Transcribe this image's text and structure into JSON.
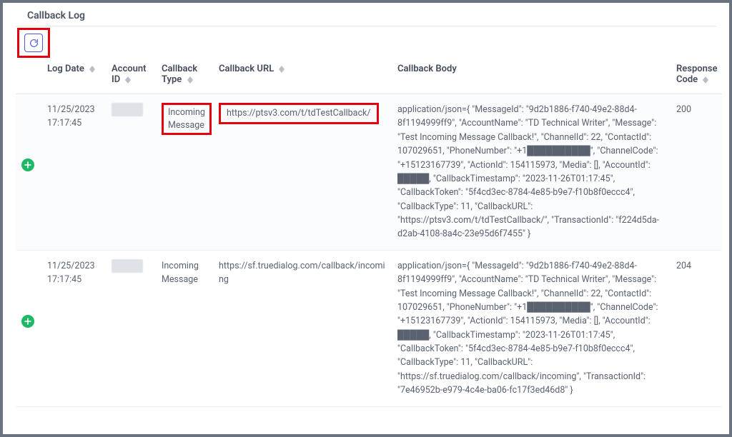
{
  "page_title": "Callback Log",
  "columns": {
    "log_date": "Log Date",
    "account_id": "Account ID",
    "callback_type": "Callback Type",
    "callback_url": "Callback URL",
    "callback_body": "Callback Body",
    "response_code": "Response Code"
  },
  "rows": [
    {
      "log_date": "11/25/2023 17:17:45",
      "account_id": "█████",
      "callback_type": "Incoming Message",
      "callback_url": "https://ptsv3.com/t/tdTestCallback/",
      "callback_body": "application/json={ \"MessageId\": \"9d2b1886-f740-49e2-88d4-8f1194999ff9\", \"AccountName\": \"TD Technical Writer\", \"Message\": \"Test Incoming Message Callback!\", \"ChannelId\": 22, \"ContactId\": 107029651, \"PhoneNumber\": \"+1██████████\", \"ChannelCode\": \"+15123167739\", \"ActionId\": 154115973, \"Media\": [], \"AccountId\": █████, \"CallbackTimestamp\": \"2023-11-26T01:17:45\", \"CallbackToken\": \"5f4cd3ec-8784-4e85-b9e7-f10b8f0eccc4\", \"CallbackType\": 11, \"CallbackURL\": \"https://ptsv3.com/t/tdTestCallback/\", \"TransactionId\": \"f224d5da-d2ab-4108-8a4c-23e95d6f7455\" }",
      "response_code": "200"
    },
    {
      "log_date": "11/25/2023 17:17:45",
      "account_id": "█████",
      "callback_type": "Incoming Message",
      "callback_url": "https://sf.truedialog.com/callback/incoming",
      "callback_body": "application/json={ \"MessageId\": \"9d2b1886-f740-49e2-88d4-8f1194999ff9\", \"AccountName\": \"TD Technical Writer\", \"Message\": \"Test Incoming Message Callback!\", \"ChannelId\": 22, \"ContactId\": 107029651, \"PhoneNumber\": \"+1██████████\", \"ChannelCode\": \"+15123167739\", \"ActionId\": 154115973, \"Media\": [], \"AccountId\": █████, \"CallbackTimestamp\": \"2023-11-26T01:17:45\", \"CallbackToken\": \"5f4cd3ec-8784-4e85-b9e7-f10b8f0eccc4\", \"CallbackType\": 11, \"CallbackURL\": \"https://sf.truedialog.com/callback/incoming\", \"TransactionId\": \"7e46952b-e979-4c4e-ba06-fc17f3ed46d8\" }",
      "response_code": "204"
    }
  ]
}
